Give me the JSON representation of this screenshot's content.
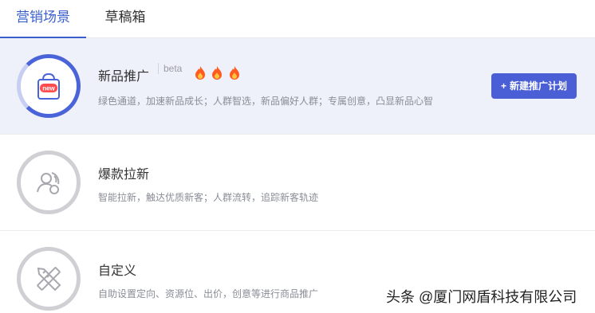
{
  "tabs": [
    {
      "label": "营销场景",
      "active": true
    },
    {
      "label": "草稿箱",
      "active": false
    }
  ],
  "colors": {
    "accent": "#3a5fcd",
    "button": "#4a5fd6",
    "flame": "#ff5a1f"
  },
  "cards": [
    {
      "title": "新品推广",
      "badge": "beta",
      "hot_icons": [
        "flame-icon",
        "flame-icon",
        "flame-icon"
      ],
      "icon_label": "new",
      "icon": "shopping-bag-icon",
      "desc": "绿色通道，加速新品成长；人群智选，新品偏好人群；专属创意，凸显新品心智",
      "button": {
        "label": "新建推广计划",
        "icon": "plus-icon"
      }
    },
    {
      "title": "爆款拉新",
      "icon": "user-target-icon",
      "desc": "智能拉新，触达优质新客；人群流转，追踪新客轨迹"
    },
    {
      "title": "自定义",
      "icon": "pencil-ruler-icon",
      "desc": "自助设置定向、资源位、出价，创意等进行商品推广"
    }
  ],
  "watermark": "头条 @厦门网盾科技有限公司"
}
